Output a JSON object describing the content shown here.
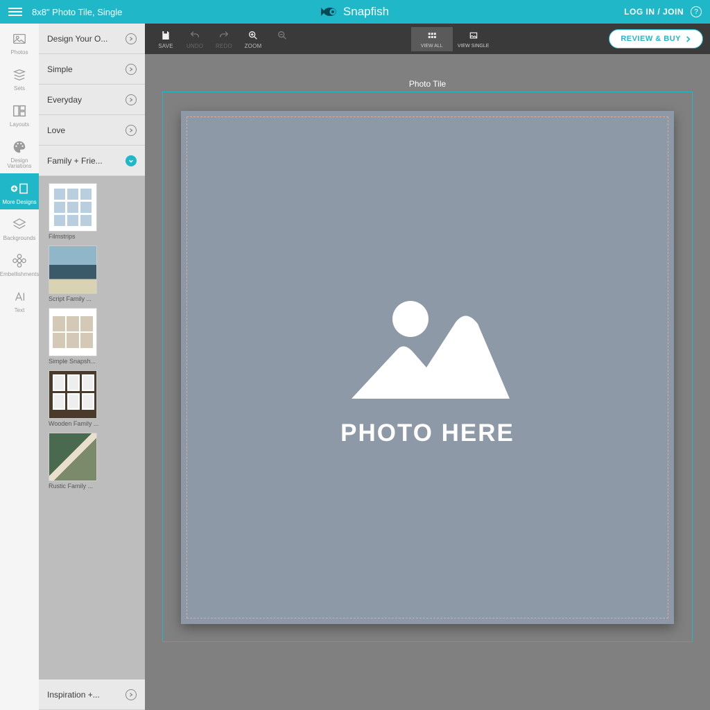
{
  "topbar": {
    "product_title": "8x8\" Photo Tile, Single",
    "brand_name": "Snapfish",
    "login_label": "LOG IN / JOIN",
    "help_glyph": "?"
  },
  "toolstrip": {
    "items": [
      {
        "label": "Photos"
      },
      {
        "label": "Sets"
      },
      {
        "label": "Layouts"
      },
      {
        "label": "Design Variations"
      },
      {
        "label": "More Designs"
      },
      {
        "label": "Backgrounds"
      },
      {
        "label": "Embellishments"
      },
      {
        "label": "Text"
      }
    ],
    "active_index": 4
  },
  "design_categories": [
    {
      "label": "Design Your O..."
    },
    {
      "label": "Simple"
    },
    {
      "label": "Everyday"
    },
    {
      "label": "Love"
    },
    {
      "label": "Family + Frie..."
    },
    {
      "label": "Inspiration +..."
    }
  ],
  "expanded_category_index": 4,
  "design_items": [
    {
      "name": "Filmstrips"
    },
    {
      "name": "Script Family ..."
    },
    {
      "name": "Simple Snapsh..."
    },
    {
      "name": "Wooden Family ..."
    },
    {
      "name": "Rustic Family ..."
    }
  ],
  "editor_toolbar": {
    "save": "SAVE",
    "undo": "UNDO",
    "redo": "REDO",
    "zoom": "ZOOM",
    "view_all": "VIEW ALL",
    "view_single": "VIEW SINGLE",
    "review_buy": "REVIEW & BUY"
  },
  "canvas": {
    "title": "Photo Tile",
    "placeholder_text": "PHOTO HERE"
  },
  "colors": {
    "brand": "#20b8c9",
    "toolbar_dark": "#3a3a3a",
    "canvas_bg": "#808080",
    "tile_bg": "#8e99a8"
  }
}
